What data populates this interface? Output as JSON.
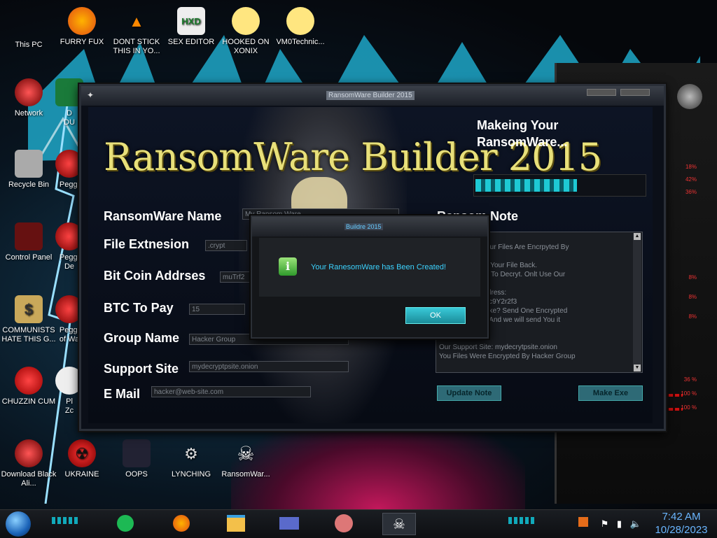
{
  "desktop": {
    "icons": [
      {
        "id": "this-pc",
        "label": "This PC",
        "glyph": "🖥"
      },
      {
        "id": "firefox",
        "label": "FURRY FUX",
        "glyph": "🦊"
      },
      {
        "id": "vlc",
        "label": "DONT STICK THIS IN YO...",
        "glyph": "▲"
      },
      {
        "id": "hxd",
        "label": "SEX EDITOR",
        "glyph": "HXD"
      },
      {
        "id": "xonix",
        "label": "HOOKED ON XONIX",
        "glyph": "☺"
      },
      {
        "id": "vm0",
        "label": "VM0Technic...",
        "glyph": "☺"
      },
      {
        "id": "network",
        "label": "Network",
        "glyph": "⬤"
      },
      {
        "id": "d-du",
        "label": "D\nDU",
        "glyph": "▣"
      },
      {
        "id": "recycle",
        "label": "Recycle Bin",
        "glyph": "🗑"
      },
      {
        "id": "peggl1",
        "label": "Peggl",
        "glyph": "◉"
      },
      {
        "id": "control",
        "label": "Control Panel",
        "glyph": "▤"
      },
      {
        "id": "peggl2",
        "label": "Peggl\nDe",
        "glyph": "◉"
      },
      {
        "id": "communists",
        "label": "COMMUNISTS HATE THIS G...",
        "glyph": "$"
      },
      {
        "id": "peggl3",
        "label": "Peggl\nof Wa",
        "glyph": "◉"
      },
      {
        "id": "chuzzin",
        "label": "CHUZZIN CUM",
        "glyph": "●"
      },
      {
        "id": "plzc",
        "label": "Pl\nZc",
        "glyph": "✿"
      },
      {
        "id": "download",
        "label": "Download Black Ali...",
        "glyph": "⬤"
      },
      {
        "id": "ukraine",
        "label": "UKRAINE",
        "glyph": "☢"
      },
      {
        "id": "oops",
        "label": "OOPS",
        "glyph": "▣"
      },
      {
        "id": "lynching",
        "label": "LYNCHING",
        "glyph": "⚙"
      },
      {
        "id": "ransomwar",
        "label": "RansomWar...",
        "glyph": "☠"
      }
    ]
  },
  "hud": {
    "values": [
      "18%",
      "42%",
      "36%",
      "8%",
      "8%",
      "8%",
      "36 %",
      "100 %",
      "100 %"
    ],
    "levels": [
      0.18,
      0.42,
      0.36,
      0.08,
      0.08,
      0.08,
      0.36,
      1.0,
      1.0
    ]
  },
  "app": {
    "title": "RansomWare Builder 2015",
    "banner": "RansomWare Builder 2015",
    "making": "Makeing Your\nRansomWare...",
    "progress": 0.6,
    "fields": [
      {
        "label": "RansomWare Name",
        "value": "My Ransom Ware"
      },
      {
        "label": "File Extnesion",
        "value": ".crypt"
      },
      {
        "label": "Bit Coin Addrses",
        "value": "muTrf2"
      },
      {
        "label": "BTC To Pay",
        "value": "15"
      },
      {
        "label": "Group Name",
        "value": "Hacker Group"
      },
      {
        "label": "Support Site",
        "value": "mydecryptpsite.onion"
      },
      {
        "label": "E Mail",
        "value": "hacker@web-site.com"
      }
    ],
    "note_header": "Ransom Note",
    "note_text": "So Sorry. But Your Files Are Encrpyted By\nre\nry! You Can Get Your File Back.\nUse Other Tools To Decryt. Onlt Use Our\n\nOur Bit Coin Address:\nvpS9TY4fEioU4c9Y2r2f3\nous We Aere Fake? Send One Encrypted\n@web-site.com And we will send You it\n\n\nOur Support Site: mydecrytpsite.onion\nYou Files Were Encrypted By Hacker Group",
    "update_button": "Update Note",
    "make_button": "Make Exe"
  },
  "dialog": {
    "title": "Buildre 2015",
    "message": "Your RanesomWare has Been Created!",
    "ok": "OK"
  },
  "taskbar": {
    "time": "7:42 AM",
    "date": "10/28/2023"
  }
}
